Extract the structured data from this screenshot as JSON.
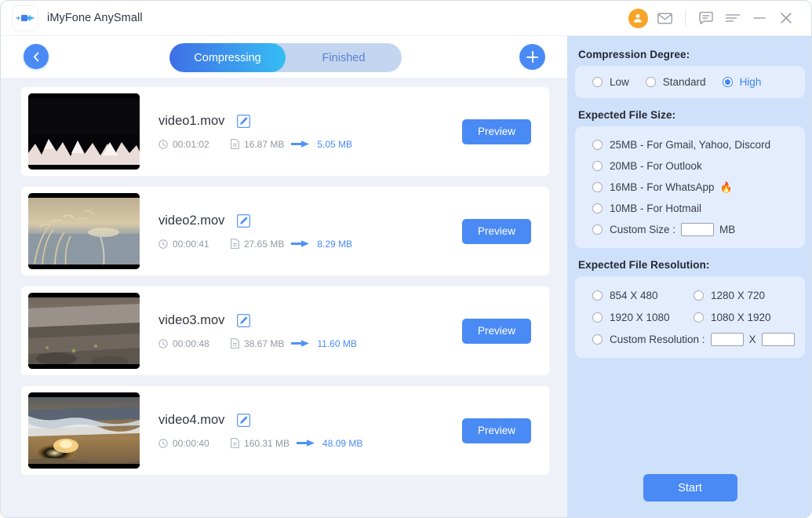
{
  "titlebar": {
    "app_name": "iMyFone AnySmall",
    "logo_icon": "video-compress-logo-icon",
    "icons": [
      {
        "name": "account-avatar",
        "glyph": "person"
      },
      {
        "name": "mail-icon",
        "glyph": "envelope"
      },
      {
        "name": "feedback-icon",
        "glyph": "chat-bubble"
      },
      {
        "name": "menu-icon",
        "glyph": "hamburger"
      },
      {
        "name": "minimize-icon",
        "glyph": "minus"
      },
      {
        "name": "close-icon",
        "glyph": "cross"
      }
    ],
    "avatar_color": "#f7a428"
  },
  "toolbar": {
    "back_icon": "chevron-left-icon",
    "add_icon": "plus-icon",
    "tabs": [
      {
        "label": "Compressing",
        "active": true
      },
      {
        "label": "Finished",
        "active": false
      }
    ]
  },
  "videos": [
    {
      "name": "video1.mov",
      "duration": "00:01:02",
      "original_size": "16.87 MB",
      "new_size": "5.05 MB",
      "preview_label": "Preview"
    },
    {
      "name": "video2.mov",
      "duration": "00:00:41",
      "original_size": "27.65 MB",
      "new_size": "8.29 MB",
      "preview_label": "Preview"
    },
    {
      "name": "video3.mov",
      "duration": "00:00:48",
      "original_size": "38.67 MB",
      "new_size": "11.60 MB",
      "preview_label": "Preview"
    },
    {
      "name": "video4.mov",
      "duration": "00:00:40",
      "original_size": "160.31 MB",
      "new_size": "48.09 MB",
      "preview_label": "Preview"
    }
  ],
  "settings": {
    "compression_degree": {
      "title": "Compression Degree:",
      "options": [
        {
          "label": "Low",
          "selected": false
        },
        {
          "label": "Standard",
          "selected": false
        },
        {
          "label": "High",
          "selected": true
        }
      ]
    },
    "expected_file_size": {
      "title": "Expected File Size:",
      "options": [
        {
          "label": "25MB - For Gmail, Yahoo, Discord",
          "selected": false,
          "badge": ""
        },
        {
          "label": "20MB - For Outlook",
          "selected": false,
          "badge": ""
        },
        {
          "label": "16MB - For WhatsApp",
          "selected": false,
          "badge": "🔥"
        },
        {
          "label": "10MB - For Hotmail",
          "selected": false,
          "badge": ""
        }
      ],
      "custom": {
        "label": "Custom Size :",
        "value": "",
        "unit": "MB",
        "selected": false
      }
    },
    "expected_file_resolution": {
      "title": "Expected File Resolution:",
      "options": [
        {
          "label": "854 X 480",
          "selected": false
        },
        {
          "label": "1280 X 720",
          "selected": false
        },
        {
          "label": "1920 X 1080",
          "selected": false
        },
        {
          "label": "1080 X 1920",
          "selected": false
        }
      ],
      "custom": {
        "label": "Custom Resolution :",
        "width_value": "",
        "separator": "X",
        "height_value": "",
        "selected": false
      }
    },
    "start_label": "Start"
  },
  "colors": {
    "accent_blue": "#4a8af4",
    "tab_gradient_start": "#3f6fe6",
    "tab_gradient_end": "#35bdf3",
    "panel_blue": "#cfe0fb",
    "card_blue": "#e3edfd",
    "list_bg": "#eef1f8",
    "avatar_orange": "#f7a428"
  }
}
